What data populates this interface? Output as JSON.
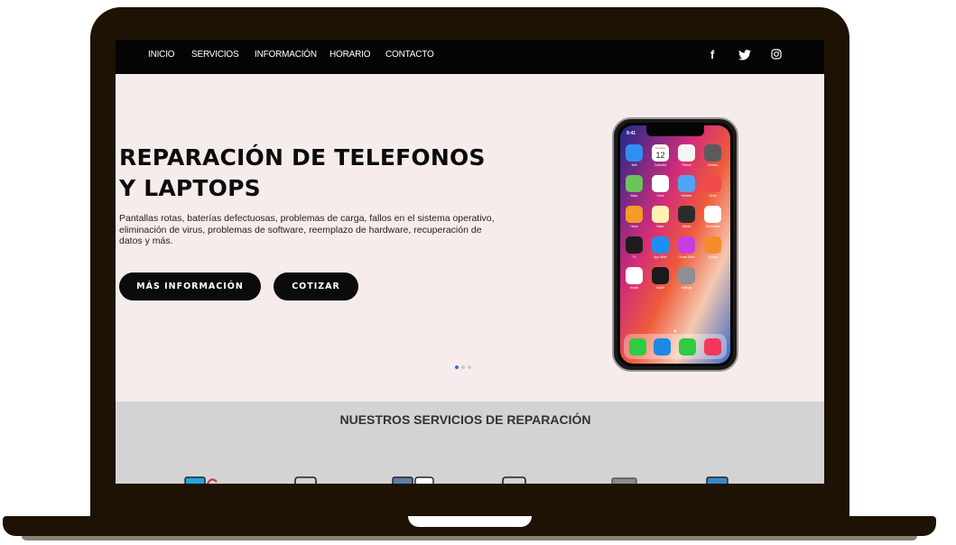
{
  "nav": {
    "links": [
      "INICIO",
      "SERVICIOS",
      "INFORMACIÓN",
      "HORARIO",
      "CONTACTO"
    ],
    "social": {
      "facebook": "f",
      "twitter": "twitter-icon",
      "instagram": "instagram-icon"
    }
  },
  "hero": {
    "title_line1": "REPARACIÓN DE TELEFONOS",
    "title_line2": "Y LAPTOPS",
    "description": "Pantallas rotas, baterías defectuosas, problemas de carga, fallos en el sistema operativo, eliminación de virus, problemas de software, reemplazo de hardware, recuperación de datos y más.",
    "primary_button": "MÁS INFORMACIÓN",
    "secondary_button": "COTIZAR",
    "carousel": {
      "count": 3,
      "active": 0
    }
  },
  "phone": {
    "time": "9:41",
    "calendar_day": "Tuesday",
    "calendar_date": "12",
    "apps": [
      "Mail",
      "Calendar",
      "Photos",
      "Camera",
      "Maps",
      "Clock",
      "Weather",
      "News",
      "Home",
      "Notes",
      "Stocks",
      "Reminders",
      "TV",
      "App Store",
      "iTunes Store",
      "iBooks",
      "Health",
      "Wallet",
      "Settings"
    ]
  },
  "services": {
    "title": "NUESTROS SERVICIOS DE REPARACIÓN"
  },
  "colors": {
    "frame": "#1e1204",
    "nav_bg": "#050505",
    "hero_bg": "#f7ecec",
    "button_bg": "#0b0b0b",
    "services_bg": "#d3d3d3",
    "dot_active": "#2d6fe0",
    "dot_inactive": "#c9c9c9"
  }
}
